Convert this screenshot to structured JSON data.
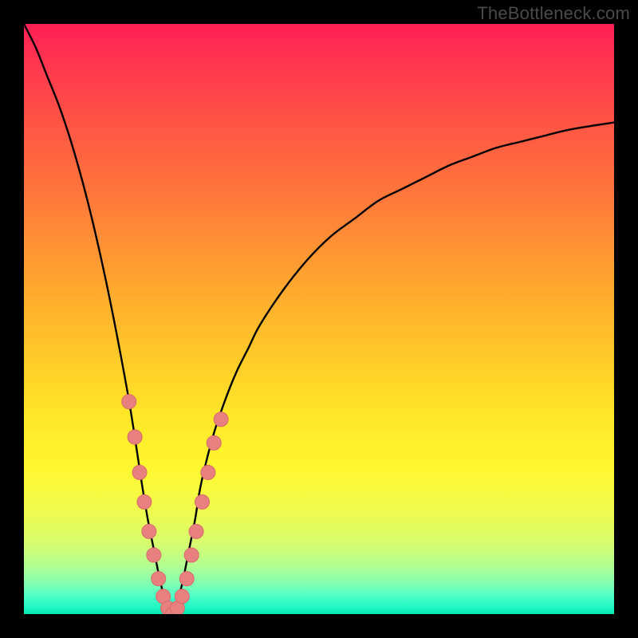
{
  "watermark": {
    "text": "TheBottleneck.com"
  },
  "colors": {
    "frame": "#000000",
    "curve_stroke": "#000000",
    "marker_fill": "#e88080",
    "marker_stroke": "#d86a6a",
    "gradient_top": "#ff1f55",
    "gradient_bottom": "#00e8b0"
  },
  "chart_data": {
    "type": "line",
    "title": "",
    "xlabel": "",
    "ylabel": "",
    "xlim": [
      0,
      100
    ],
    "ylim": [
      0,
      100
    ],
    "note": "V-shaped bottleneck curve over a red→green vertical heat gradient. Values approach 0 near x≈25 and rise toward both x extremes. Markers cluster on both branches near the minimum (roughly y<35).",
    "series": [
      {
        "name": "bottleneck-curve",
        "x": [
          0,
          2,
          4,
          6,
          8,
          10,
          12,
          14,
          16,
          18,
          20,
          21,
          22,
          23,
          24,
          25,
          26,
          27,
          28,
          29,
          30,
          32,
          34,
          36,
          38,
          40,
          44,
          48,
          52,
          56,
          60,
          64,
          68,
          72,
          76,
          80,
          84,
          88,
          92,
          96,
          100
        ],
        "y": [
          100,
          96,
          91,
          86,
          80,
          73,
          65,
          56,
          46,
          35,
          22,
          16,
          11,
          6,
          2,
          0,
          2,
          6,
          11,
          16,
          22,
          30,
          36,
          41,
          45,
          49,
          55,
          60,
          64,
          67,
          70,
          72,
          74,
          76,
          77.5,
          79,
          80,
          81,
          82,
          82.7,
          83.3
        ]
      }
    ],
    "markers": {
      "name": "sample-points",
      "x": [
        17.8,
        18.8,
        19.6,
        20.4,
        21.2,
        22.0,
        22.8,
        23.6,
        24.4,
        25.2,
        26.0,
        26.8,
        27.6,
        28.4,
        29.2,
        30.2,
        31.2,
        32.2,
        33.4
      ],
      "y": [
        36,
        30,
        24,
        19,
        14,
        10,
        6,
        3,
        1,
        0,
        1,
        3,
        6,
        10,
        14,
        19,
        24,
        29,
        33
      ]
    }
  }
}
